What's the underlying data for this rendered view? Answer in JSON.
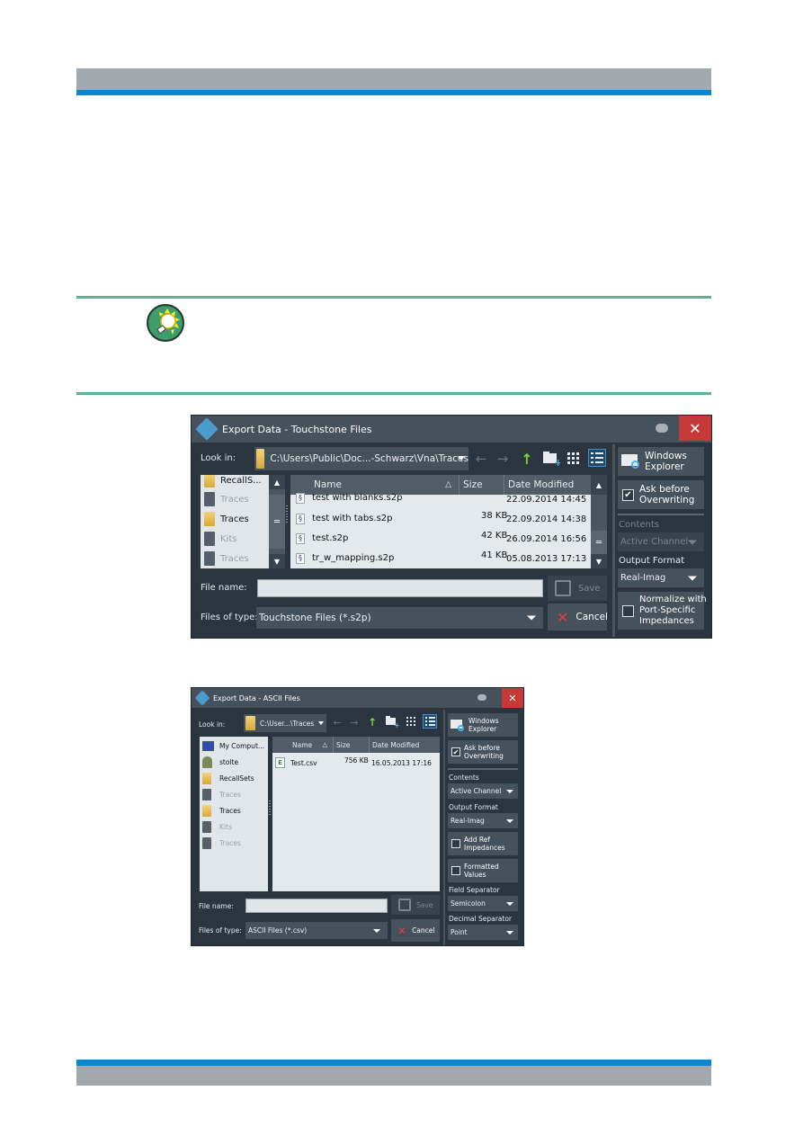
{
  "page": {
    "tip_icon": "lightbulb-tip-icon"
  },
  "dialog1": {
    "title": "Export Data - Touchstone Files",
    "look_in_label": "Look in:",
    "look_in_path": "C:\\Users\\Public\\Doc...-Schwarz\\Vna\\Traces",
    "places": [
      {
        "label": "RecallS...",
        "icon": "folder",
        "enabled": true
      },
      {
        "label": "Traces",
        "icon": "drive",
        "enabled": false
      },
      {
        "label": "Traces",
        "icon": "folder",
        "enabled": true
      },
      {
        "label": "Kits",
        "icon": "drive",
        "enabled": false
      },
      {
        "label": "Traces",
        "icon": "drive",
        "enabled": false
      }
    ],
    "columns": {
      "name": "Name",
      "size": "Size",
      "date": "Date Modified"
    },
    "files": [
      {
        "name": "test with blanks.s2p",
        "size": "",
        "date": "22.09.2014 14:45"
      },
      {
        "name": "test with tabs.s2p",
        "size": "38 KB",
        "date": "22.09.2014 14:38"
      },
      {
        "name": "test.s2p",
        "size": "42 KB",
        "date": "26.09.2014 16:56"
      },
      {
        "name": "tr_w_mapping.s2p",
        "size": "41 KB",
        "date": "05.08.2013 17:13"
      }
    ],
    "file_name_label": "File name:",
    "file_name_value": "",
    "files_of_type_label": "Files of type:",
    "files_of_type_value": "Touchstone Files (*.s2p)",
    "save_label": "Save",
    "cancel_label": "Cancel",
    "windows_explorer_label_1": "Windows",
    "windows_explorer_label_2": "Explorer",
    "ask_overwrite_label_1": "Ask before",
    "ask_overwrite_label_2": "Overwriting",
    "ask_overwrite_checked": true,
    "contents_label": "Contents",
    "contents_value": "Active Channel",
    "output_format_label": "Output Format",
    "output_format_value": "Real-Imag",
    "normalize_label_1": "Normalize with",
    "normalize_label_2": "Port-Specific",
    "normalize_label_3": "Impedances",
    "normalize_checked": false
  },
  "dialog2": {
    "title": "Export Data - ASCII Files",
    "look_in_label": "Look in:",
    "look_in_path": "C:\\User...\\Traces",
    "places": [
      {
        "label": "My Comput...",
        "icon": "computer",
        "enabled": true
      },
      {
        "label": "stolte",
        "icon": "user",
        "enabled": true
      },
      {
        "label": "RecallSets",
        "icon": "folder",
        "enabled": true
      },
      {
        "label": "Traces",
        "icon": "drive",
        "enabled": false
      },
      {
        "label": "Traces",
        "icon": "folder",
        "enabled": true
      },
      {
        "label": "Kits",
        "icon": "drive",
        "enabled": false
      },
      {
        "label": "Traces",
        "icon": "drive",
        "enabled": false
      }
    ],
    "columns": {
      "name": "Name",
      "size": "Size",
      "date": "Date Modified"
    },
    "files": [
      {
        "name": "Test.csv",
        "size": "756 KB",
        "date": "16.05.2013 17:16"
      }
    ],
    "file_name_label": "File name:",
    "file_name_value": "",
    "files_of_type_label": "Files of type:",
    "files_of_type_value": "ASCII Files (*.csv)",
    "save_label": "Save",
    "cancel_label": "Cancel",
    "windows_explorer_label_1": "Windows",
    "windows_explorer_label_2": "Explorer",
    "ask_overwrite_label_1": "Ask before",
    "ask_overwrite_label_2": "Overwriting",
    "ask_overwrite_checked": true,
    "contents_label": "Contents",
    "contents_value": "Active Channel",
    "output_format_label": "Output Format",
    "output_format_value": "Real-Imag",
    "add_ref_label_1": "Add Ref",
    "add_ref_label_2": "Impedances",
    "add_ref_checked": false,
    "formatted_label_1": "Formatted",
    "formatted_label_2": "Values",
    "formatted_checked": false,
    "field_sep_label": "Field Separator",
    "field_sep_value": "Semicolon",
    "decimal_sep_label": "Decimal Separator",
    "decimal_sep_value": "Point"
  }
}
